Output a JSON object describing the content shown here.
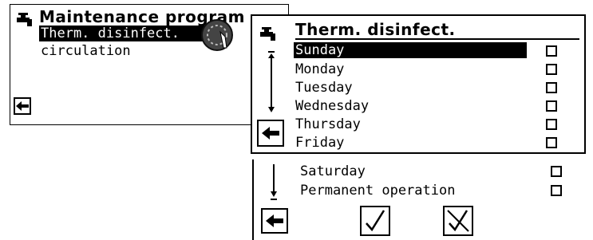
{
  "screen1": {
    "title": "Maintenance program",
    "items": [
      "Therm. disinfect.",
      "circulation"
    ]
  },
  "screen2": {
    "title": "Therm. disinfect.",
    "days": [
      "Sunday",
      "Monday",
      "Tuesday",
      "Wednesday",
      "Thursday",
      "Friday"
    ]
  },
  "screen3": {
    "items": [
      "Saturday",
      "Permanent operation"
    ]
  },
  "icons": {
    "tap": "faucet-icon",
    "back": "back-arrow-icon",
    "dial": "rotary-knob-icon",
    "confirm": "check-icon",
    "cancel": "cancel-icon",
    "scroll": "scroll-indicator-icon"
  }
}
